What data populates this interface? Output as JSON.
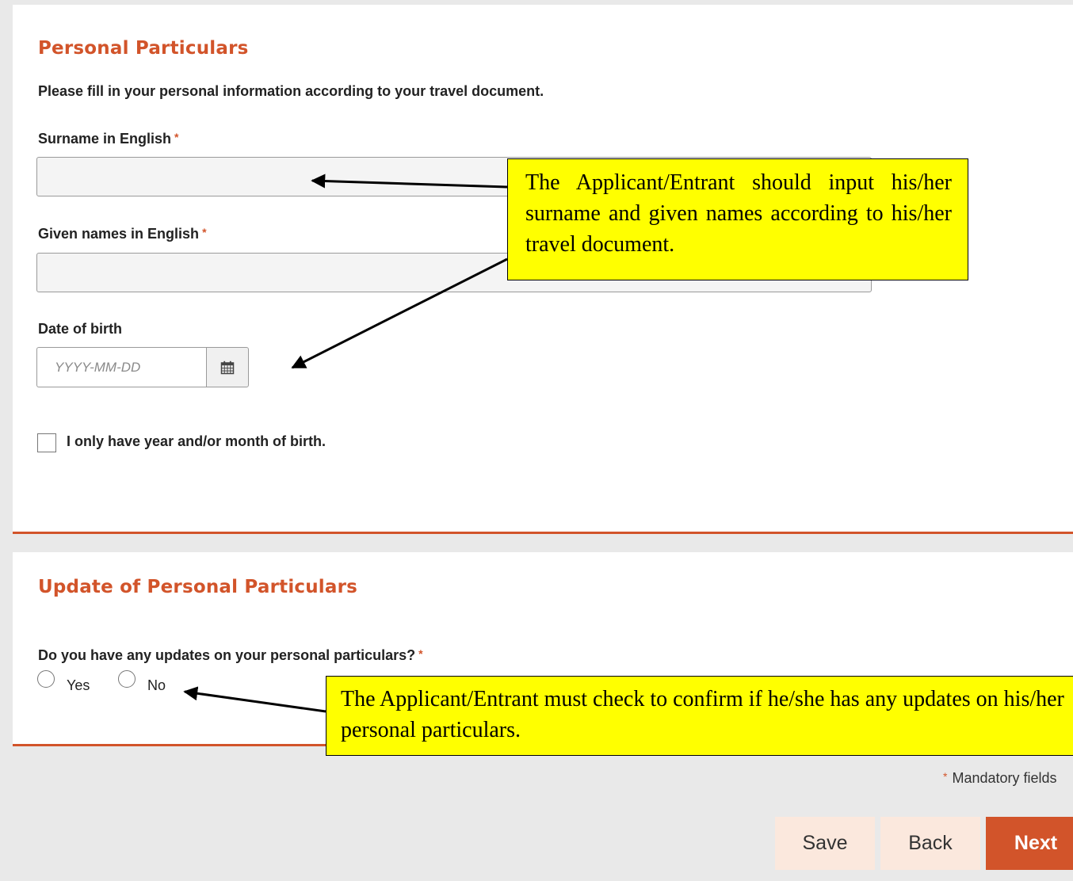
{
  "personal": {
    "title": "Personal Particulars",
    "intro": "Please fill in your personal information according to your travel document.",
    "surname_label": "Surname in English",
    "given_label": "Given names in English",
    "required_mark": "*",
    "dob_label": "Date of birth",
    "dob_placeholder": "YYYY-MM-DD",
    "partial_dob_label": "I only have year and/or month of birth."
  },
  "updates": {
    "title": "Update of Personal Particulars",
    "question": "Do you have any updates on your personal particulars?",
    "required_mark": "*",
    "yes_label": "Yes",
    "no_label": "No"
  },
  "footer": {
    "mandatory_star": "*",
    "mandatory_label": "Mandatory fields",
    "save_label": "Save",
    "back_label": "Back",
    "next_label": "Next"
  },
  "annotations": {
    "names_note": "The Applicant/Entrant should input his/her surname and given names according to his/her travel document.",
    "updates_note": "The Applicant/Entrant must check to confirm if he/she has any updates on his/her personal particulars."
  },
  "icons": {
    "calendar": "calendar-icon"
  },
  "colors": {
    "accent": "#d2542a",
    "callout": "#ffff00",
    "background": "#e9e9e9"
  }
}
